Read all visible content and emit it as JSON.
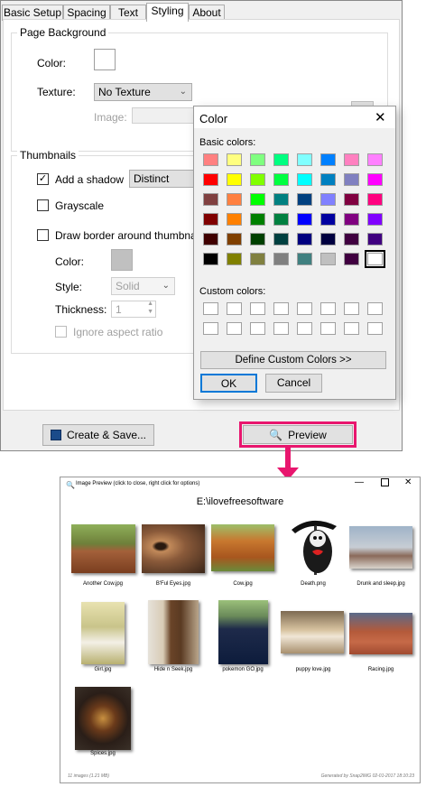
{
  "settings_window": {
    "tabs": [
      "Basic Setup",
      "Spacing",
      "Text",
      "Styling",
      "About"
    ],
    "active_tab": "Styling",
    "page_background": {
      "group_label": "Page Background",
      "color_label": "Color:",
      "texture_label": "Texture:",
      "texture_value": "No Texture",
      "image_label": "Image:"
    },
    "thumbnails": {
      "group_label": "Thumbnails",
      "add_shadow_label": "Add a shadow",
      "add_shadow_checked": true,
      "shadow_value": "Distinct",
      "grayscale_label": "Grayscale",
      "grayscale_checked": false,
      "border_label": "Draw border around thumbnails",
      "border_checked": false,
      "color_label": "Color:",
      "style_label": "Style:",
      "style_value": "Solid",
      "thickness_label": "Thickness:",
      "thickness_value": "1",
      "ignore_aspect_label": "Ignore aspect ratio"
    },
    "create_save_label": "Create & Save...",
    "preview_label": "Preview"
  },
  "color_dialog": {
    "title": "Color",
    "basic_colors_label": "Basic colors:",
    "custom_colors_label": "Custom colors:",
    "define_custom_label": "Define Custom Colors >>",
    "ok_label": "OK",
    "cancel_label": "Cancel",
    "basic_colors": [
      [
        "#ff8080",
        "#ffff80",
        "#80ff80",
        "#00ff80",
        "#80ffff",
        "#0080ff",
        "#ff80c0",
        "#ff80ff"
      ],
      [
        "#ff0000",
        "#ffff00",
        "#80ff00",
        "#00ff40",
        "#00ffff",
        "#0080c0",
        "#8080c0",
        "#ff00ff"
      ],
      [
        "#804040",
        "#ff8040",
        "#00ff00",
        "#008080",
        "#004080",
        "#8080ff",
        "#800040",
        "#ff0080"
      ],
      [
        "#800000",
        "#ff8000",
        "#008000",
        "#008040",
        "#0000ff",
        "#0000a0",
        "#800080",
        "#8000ff"
      ],
      [
        "#400000",
        "#804000",
        "#004000",
        "#004040",
        "#000080",
        "#000040",
        "#400040",
        "#400080"
      ],
      [
        "#000000",
        "#808000",
        "#808040",
        "#808080",
        "#408080",
        "#c0c0c0",
        "#400040",
        "#ffffff"
      ]
    ]
  },
  "preview_window": {
    "title": "Image Preview (click to close, right click for options)",
    "path": "E:\\ilovefreesoftware",
    "footer_left": "11 images (1.21 MB)",
    "footer_right": "Generated by Snap2IMG  02-01-2017 18:10:23",
    "images": [
      {
        "name": "Another Cow.jpg"
      },
      {
        "name": "B'Ful Eyes.jpg"
      },
      {
        "name": "Cow.jpg"
      },
      {
        "name": "Death.png"
      },
      {
        "name": "Drunk and sleep.jpg"
      },
      {
        "name": "Girl.jpg"
      },
      {
        "name": "Hide n Seek.jpg"
      },
      {
        "name": "pokemon GO.jpg"
      },
      {
        "name": "puppy love.jpg"
      },
      {
        "name": "Racing.jpg"
      },
      {
        "name": "Spices.jpg"
      }
    ]
  }
}
